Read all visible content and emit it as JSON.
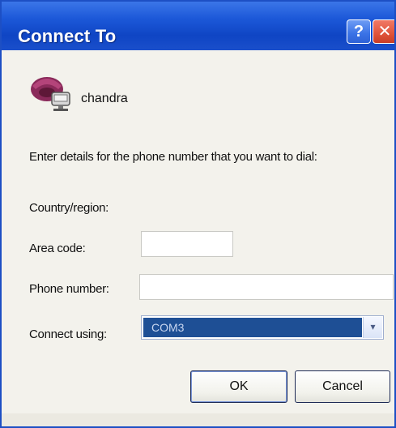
{
  "window": {
    "title": "Connect To",
    "help_label": "?",
    "close_label": "✕"
  },
  "connection": {
    "name": "chandra",
    "icon": "phone-connection-icon"
  },
  "instructions": "Enter details for the phone number that you want to dial:",
  "form": {
    "country_label": "Country/region:",
    "country_value": "",
    "area_label": "Area code:",
    "area_value": "",
    "phone_label": "Phone number:",
    "phone_value": "",
    "connect_label": "Connect using:",
    "connect_value": "COM3",
    "dropdown_icon": "chevron-down-icon"
  },
  "buttons": {
    "ok": "OK",
    "cancel": "Cancel"
  },
  "colors": {
    "titlebar": "#1c58d8",
    "selection": "#1e4f95",
    "close": "#e0533a"
  }
}
